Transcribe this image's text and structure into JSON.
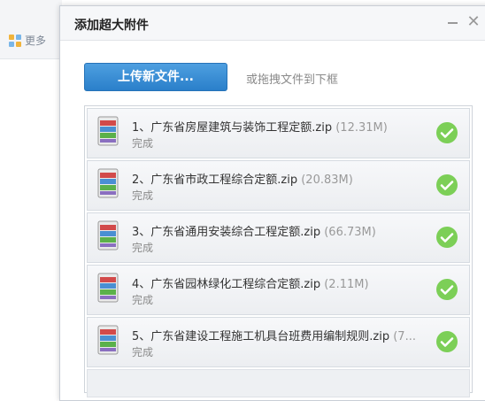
{
  "background": {
    "more_label": "更多"
  },
  "dialog": {
    "title": "添加超大附件",
    "upload_button": "上传新文件...",
    "drag_hint": "或拖拽文件到下框",
    "files": [
      {
        "name": "1、广东省房屋建筑与装饰工程定额.zip",
        "size": "(12.31M)",
        "status": "完成"
      },
      {
        "name": "2、广东省市政工程综合定额.zip",
        "size": "(20.83M)",
        "status": "完成"
      },
      {
        "name": "3、广东省通用安装综合工程定额.zip",
        "size": "(66.73M)",
        "status": "完成"
      },
      {
        "name": "4、广东省园林绿化工程综合定额.zip",
        "size": "(2.11M)",
        "status": "完成"
      },
      {
        "name": "5、广东省建设工程施工机具台班费用编制规则.zip",
        "size": "(7...",
        "status": "完成"
      }
    ]
  },
  "colors": {
    "accent": "#2a7fca",
    "success": "#7ccf57"
  }
}
